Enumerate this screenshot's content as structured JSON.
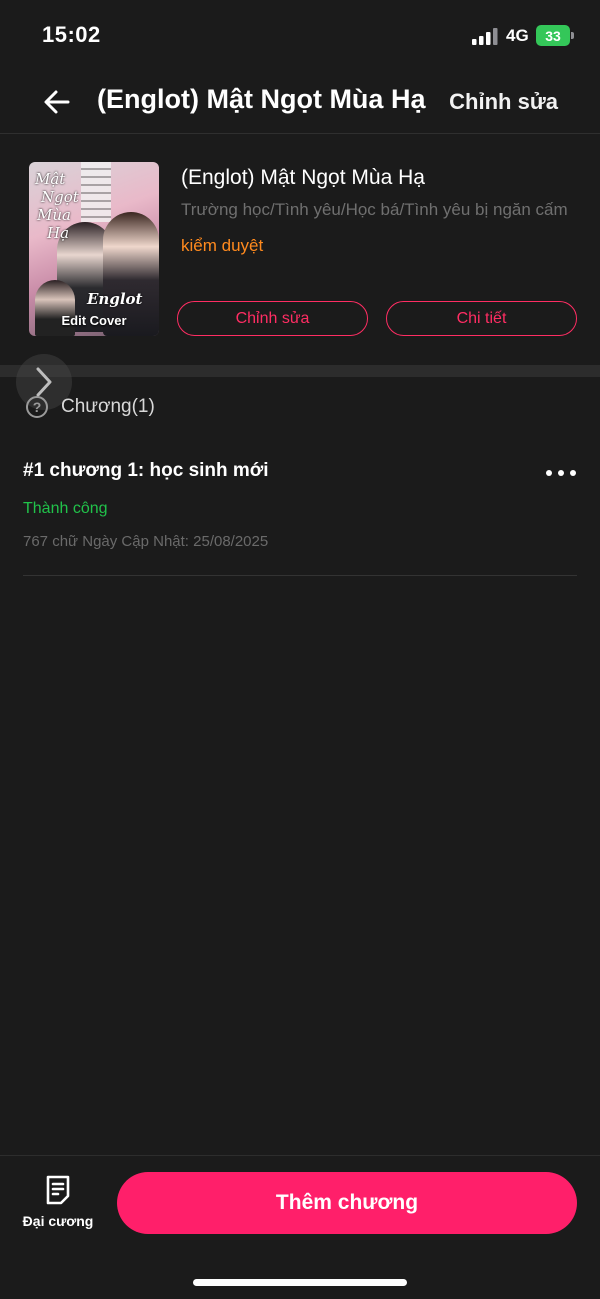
{
  "status_bar": {
    "time": "15:02",
    "network": "4G",
    "battery": "33"
  },
  "header": {
    "title": "(Englot) Mật Ngọt Mùa Hạ",
    "edit_label": "Chỉnh sửa",
    "back_icon": "back-arrow-icon"
  },
  "book": {
    "cover_script_top": [
      "Mật",
      "Ngọt",
      "Mùa",
      "Hạ"
    ],
    "cover_script_bottom": "Englot",
    "cover_edit_label": "Edit Cover",
    "title": "(Englot) Mật Ngọt Mùa Hạ",
    "tags": "Trường học/Tình yêu/Học bá/Tình yêu bị ngăn cấm",
    "status": "kiểm duyệt",
    "edit_button": "Chỉnh sửa",
    "detail_button": "Chi tiết"
  },
  "chapters_section": {
    "label": "Chương(1)"
  },
  "chapters": [
    {
      "title": "#1 chương 1: học sinh mới",
      "status": "Thành công",
      "meta": "767 chữ Ngày Cập Nhật: 25/08/2025"
    }
  ],
  "bottom": {
    "outline_label": "Đại cương",
    "add_chapter_label": "Thêm chương"
  },
  "colors": {
    "accent": "#ff1f6a",
    "pending": "#ff8a1e",
    "success": "#21c24a",
    "background": "#1b1b1b"
  }
}
